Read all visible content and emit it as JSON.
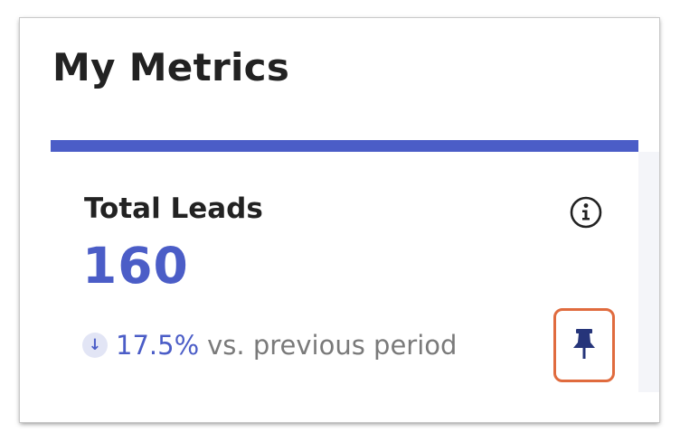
{
  "page": {
    "title": "My Metrics"
  },
  "card": {
    "title": "Total Leads",
    "value": "160",
    "trend": {
      "direction": "down",
      "percent": "17.5%",
      "comparison_text": "vs. previous period"
    },
    "accent_color": "#4b5dc7",
    "pin_highlight_color": "#e06b3e"
  },
  "icons": {
    "info": "info-icon",
    "trend": "arrow-down-icon",
    "pin": "pin-icon"
  }
}
